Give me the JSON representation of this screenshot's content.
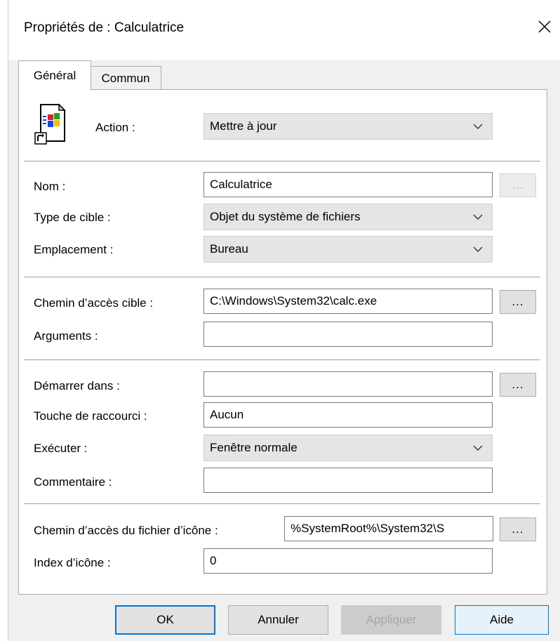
{
  "window": {
    "title": "Propriétés de : Calculatrice"
  },
  "tabs": [
    {
      "label": "Général"
    },
    {
      "label": "Commun"
    }
  ],
  "action": {
    "label": "Action :",
    "value": "Mettre à jour"
  },
  "fields": {
    "nom": {
      "label": "Nom :",
      "value": "Calculatrice"
    },
    "type_cible": {
      "label": "Type de cible :",
      "value": "Objet du système de fichiers"
    },
    "emplacement": {
      "label": "Emplacement :",
      "value": "Bureau"
    },
    "chemin_cible": {
      "label": "Chemin d’accès cible :",
      "value": "C:\\Windows\\System32\\calc.exe"
    },
    "arguments": {
      "label": "Arguments :",
      "value": ""
    },
    "demarrer": {
      "label": "Démarrer dans :",
      "value": ""
    },
    "touche": {
      "label": "Touche de raccourci :",
      "value": "Aucun"
    },
    "executer": {
      "label": "Exécuter :",
      "value": "Fenêtre normale"
    },
    "commentaire": {
      "label": "Commentaire :",
      "value": ""
    },
    "chemin_icone": {
      "label": "Chemin d’accès du fichier d’icône :",
      "value": "%SystemRoot%\\System32\\S"
    },
    "index_icone": {
      "label": "Index d’icône :",
      "value": "0"
    }
  },
  "browse_label": "...",
  "buttons": {
    "ok": "OK",
    "annuler": "Annuler",
    "appliquer": "Appliquer",
    "aide": "Aide"
  },
  "colors": {
    "accent": "#0078d7",
    "panel_bg": "#ffffff",
    "window_bg": "#f0f0f0"
  }
}
